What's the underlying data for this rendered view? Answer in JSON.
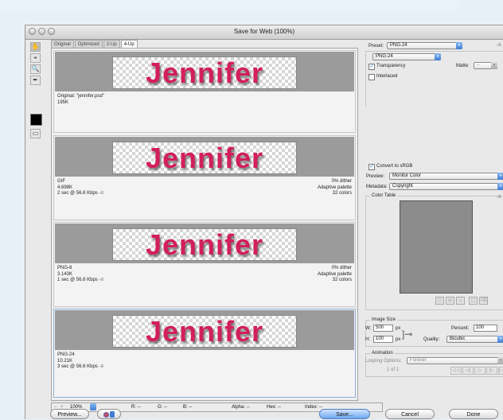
{
  "window": {
    "title": "Save for Web (100%)"
  },
  "tabs": [
    "Original",
    "Optimized",
    "2-Up",
    "4-Up"
  ],
  "tools": [
    "✋",
    "⌖",
    "🔍",
    "✒"
  ],
  "panes": [
    {
      "image_text": "Jennifer",
      "left_lines": [
        "Original: \"jennifer.psd\"",
        "195K"
      ],
      "right_lines": []
    },
    {
      "image_text": "Jennifer",
      "left_lines": [
        "GIF",
        "4.698K",
        "2 sec @ 56.6 Kbps"
      ],
      "right_lines": [
        "0% dither",
        "Adaptive palette",
        "32 colors"
      ]
    },
    {
      "image_text": "Jennifer",
      "left_lines": [
        "PNG-8",
        "3.143K",
        "1 sec @ 56.6 Kbps"
      ],
      "right_lines": [
        "0% dither",
        "Adaptive palette",
        "32 colors"
      ]
    },
    {
      "image_text": "Jennifer",
      "left_lines": [
        "PNG-24",
        "10.21K",
        "3 sec @ 56.6 Kbps"
      ],
      "right_lines": []
    }
  ],
  "menu_glyph": "-≡",
  "status": {
    "zoom": "100%",
    "r": "R: --",
    "g": "G: --",
    "b": "B: --",
    "alpha": "Alpha: --",
    "hex": "Hex: --",
    "index": "Index: --"
  },
  "buttons": {
    "preview": "Preview...",
    "save": "Save...",
    "cancel": "Cancel",
    "done": "Done"
  },
  "settings": {
    "preset_label": "Preset:",
    "preset_value": "PNG-24",
    "format_value": "PNG-24",
    "transparency_label": "Transparency",
    "matte_label": "Matte:",
    "matte_value": "--",
    "interlaced_label": "Interlaced",
    "convert_srgb_label": "Convert to sRGB",
    "preview_label": "Preview:",
    "preview_value": "Monitor Color",
    "metadata_label": "Metadata:",
    "metadata_value": "Copyright",
    "color_table_label": "Color Table",
    "image_size_label": "Image Size",
    "w_label": "W:",
    "w_value": "500",
    "h_label": "H:",
    "h_value": "100",
    "px": "px",
    "percent_label": "Percent:",
    "percent_value": "100",
    "quality_label": "Quality:",
    "quality_value": "Bicubic",
    "animation_label": "Animation",
    "looping_label": "Looping Options:",
    "looping_value": "Forever",
    "frame_counter": "1 of 1"
  },
  "colors": {
    "accent": "#3f7fd4",
    "text_pink": "#d21f5a"
  }
}
